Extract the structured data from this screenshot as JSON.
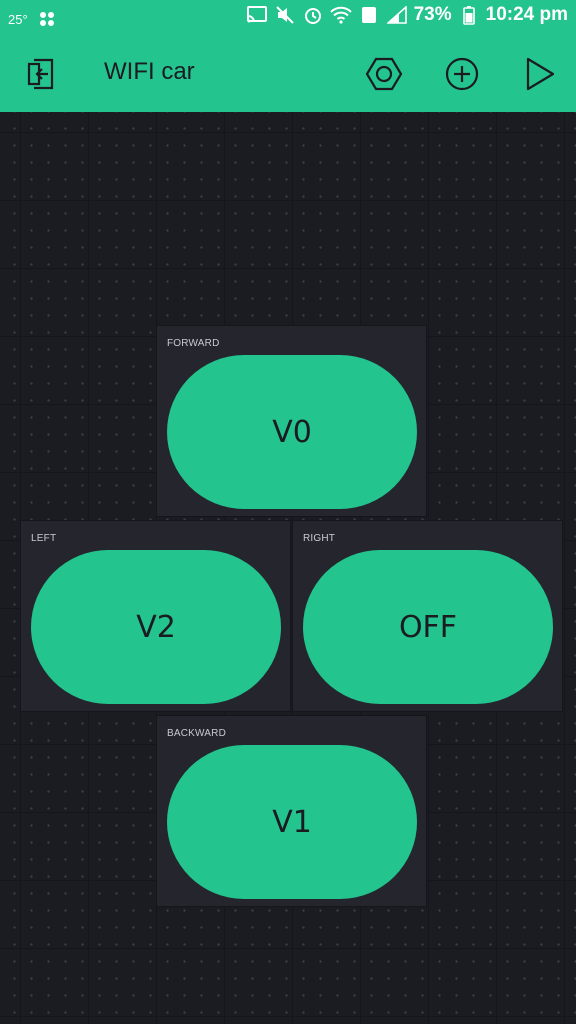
{
  "status_bar": {
    "temperature": "25°",
    "battery": "73%",
    "time": "10:24 pm",
    "sim": "1"
  },
  "toolbar": {
    "title": "WIFI car"
  },
  "widgets": [
    {
      "label": "FORWARD",
      "value": "V0"
    },
    {
      "label": "LEFT",
      "value": "V2"
    },
    {
      "label": "RIGHT",
      "value": "OFF"
    },
    {
      "label": "BACKWARD",
      "value": "V1"
    }
  ],
  "colors": {
    "accent": "#23c48e",
    "background": "#1b1c22",
    "widget_bg": "#25262d"
  }
}
